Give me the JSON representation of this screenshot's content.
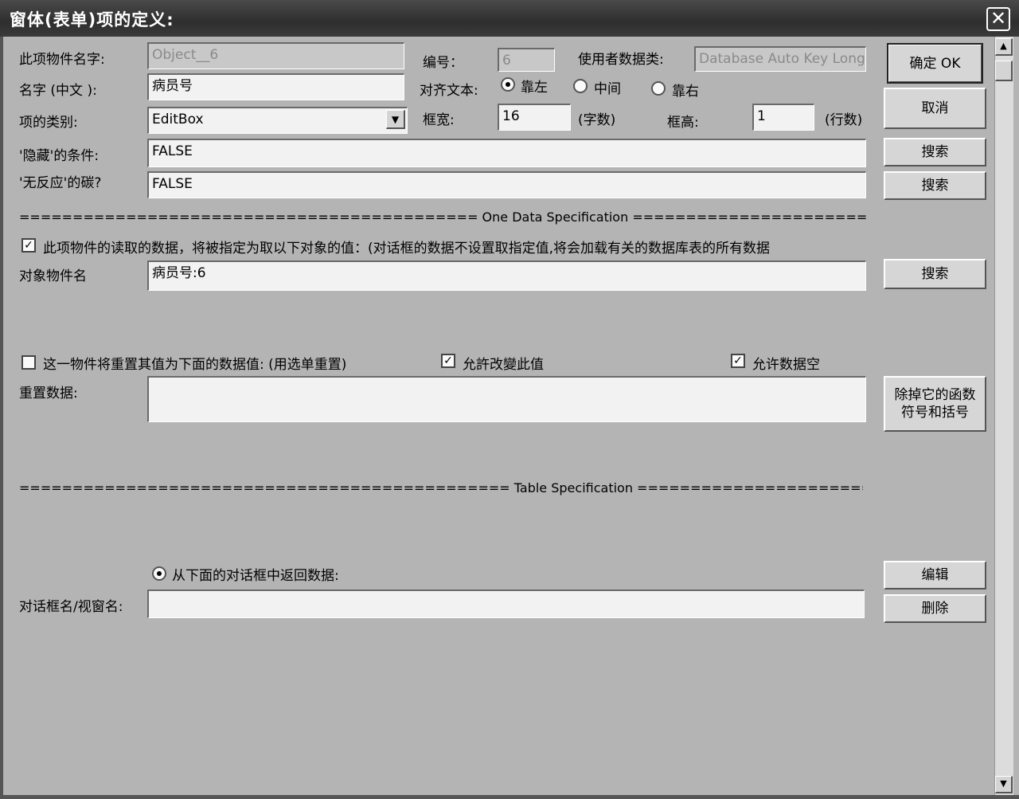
{
  "window": {
    "title": "窗体(表单)项的定义:",
    "close_symbol": "✕"
  },
  "header": {
    "object_name_label": "此项物件名字:",
    "object_name_value": "Object__6",
    "number_label": "编号：",
    "number_value": "6",
    "user_data_class_label": "使用者数据类:",
    "user_data_class_value": "Database Auto Key Long",
    "name_cn_label": "名字 (中文 ):",
    "name_cn_value": "病员号",
    "align_label": "对齐文本:",
    "align_options": [
      "靠左",
      "中间",
      "靠右"
    ],
    "align_selected": "靠左",
    "item_type_label": "项的类别:",
    "item_type_value": "EditBox",
    "width_label": "框宽:",
    "width_value": "16",
    "width_unit": "(字数)",
    "height_label": "框高:",
    "height_value": "1",
    "height_unit": "(行数)",
    "hidden_cond_label": "'隐藏'的条件:",
    "hidden_cond_value": "FALSE",
    "noresponse_label": "'无反应'的碳?",
    "noresponse_value": "FALSE"
  },
  "buttons": {
    "ok": "确定 OK",
    "cancel": "取消",
    "search1": "搜索",
    "search2": "搜索",
    "search3": "搜索",
    "remove_func_line1": "除掉它的函数",
    "remove_func_line2": "符号和括号",
    "edit": "编辑",
    "delete": "删除"
  },
  "one_data": {
    "separator": "=========================================== One Data Specification ============================================",
    "checkbox_label": "此项物件的读取的数据，将被指定为取以下对象的值：(对话框的数据不设置取指定值,将会加载有关的数据库表的所有数据",
    "checkbox_checked": true,
    "target_label": "对象物件名",
    "target_value": "病员号:6",
    "reset_label": "这一物件将重置其值为下面的数据值: (用选单重置)",
    "reset_checked": false,
    "allow_change_label": "允許改變此值",
    "allow_change_checked": true,
    "allow_empty_label": "允许数据空",
    "allow_empty_checked": true,
    "reset_data_label": "重置数据:",
    "reset_data_value": ""
  },
  "table_spec": {
    "separator": "============================================== Table Specification ===========================================",
    "return_label": "从下面的对话框中返回数据:",
    "return_selected": true,
    "dialog_name_label": "对话框名/视窗名:",
    "dialog_name_value": ""
  }
}
